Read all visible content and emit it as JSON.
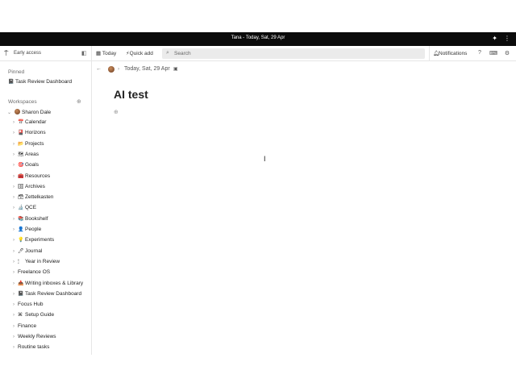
{
  "window": {
    "title": "Tana - Today, Sat, 29 Apr"
  },
  "toolbar": {
    "early_access": "Early access",
    "today": "Today",
    "quick_add": "Quick add",
    "search_placeholder": "Search",
    "notifications": "Notifications"
  },
  "sidebar": {
    "pinned_label": "Pinned",
    "pinned": [
      {
        "emoji": "📓",
        "label": "Task Review Dashboard"
      }
    ],
    "workspaces_label": "Workspaces",
    "workspace": "Sharon Dale",
    "items": [
      {
        "emoji": "📅",
        "label": "Calendar"
      },
      {
        "emoji": "🎴",
        "label": "Horizons"
      },
      {
        "emoji": "📂",
        "label": "Projects"
      },
      {
        "emoji": "🗺",
        "label": "Areas"
      },
      {
        "emoji": "🎯",
        "label": "Goals"
      },
      {
        "emoji": "🧰",
        "label": "Resources"
      },
      {
        "emoji": "🗄",
        "label": "Archives"
      },
      {
        "emoji": "🗃",
        "label": "Zettelkasten"
      },
      {
        "emoji": "🔬",
        "label": "QCE"
      },
      {
        "emoji": "📚",
        "label": "Bookshelf"
      },
      {
        "emoji": "👤",
        "label": "People"
      },
      {
        "emoji": "💡",
        "label": "Experiments"
      },
      {
        "emoji": "🖊",
        "label": "Journal"
      },
      {
        "emoji": "🕯",
        "label": "Year in Review"
      },
      {
        "emoji": "",
        "label": "Freelance OS"
      },
      {
        "emoji": "📥",
        "label": "Writing inboxes & Library"
      },
      {
        "emoji": "📓",
        "label": "Task Review Dashboard"
      },
      {
        "emoji": "",
        "label": "Focus Hub"
      },
      {
        "emoji": "⌘",
        "label": "Setup Guide"
      },
      {
        "emoji": "",
        "label": "Finance"
      },
      {
        "emoji": "",
        "label": "Weekly Reviews"
      },
      {
        "emoji": "",
        "label": "Routine tasks"
      }
    ]
  },
  "main": {
    "breadcrumb": "Today, Sat, 29 Apr",
    "title": "AI test"
  }
}
